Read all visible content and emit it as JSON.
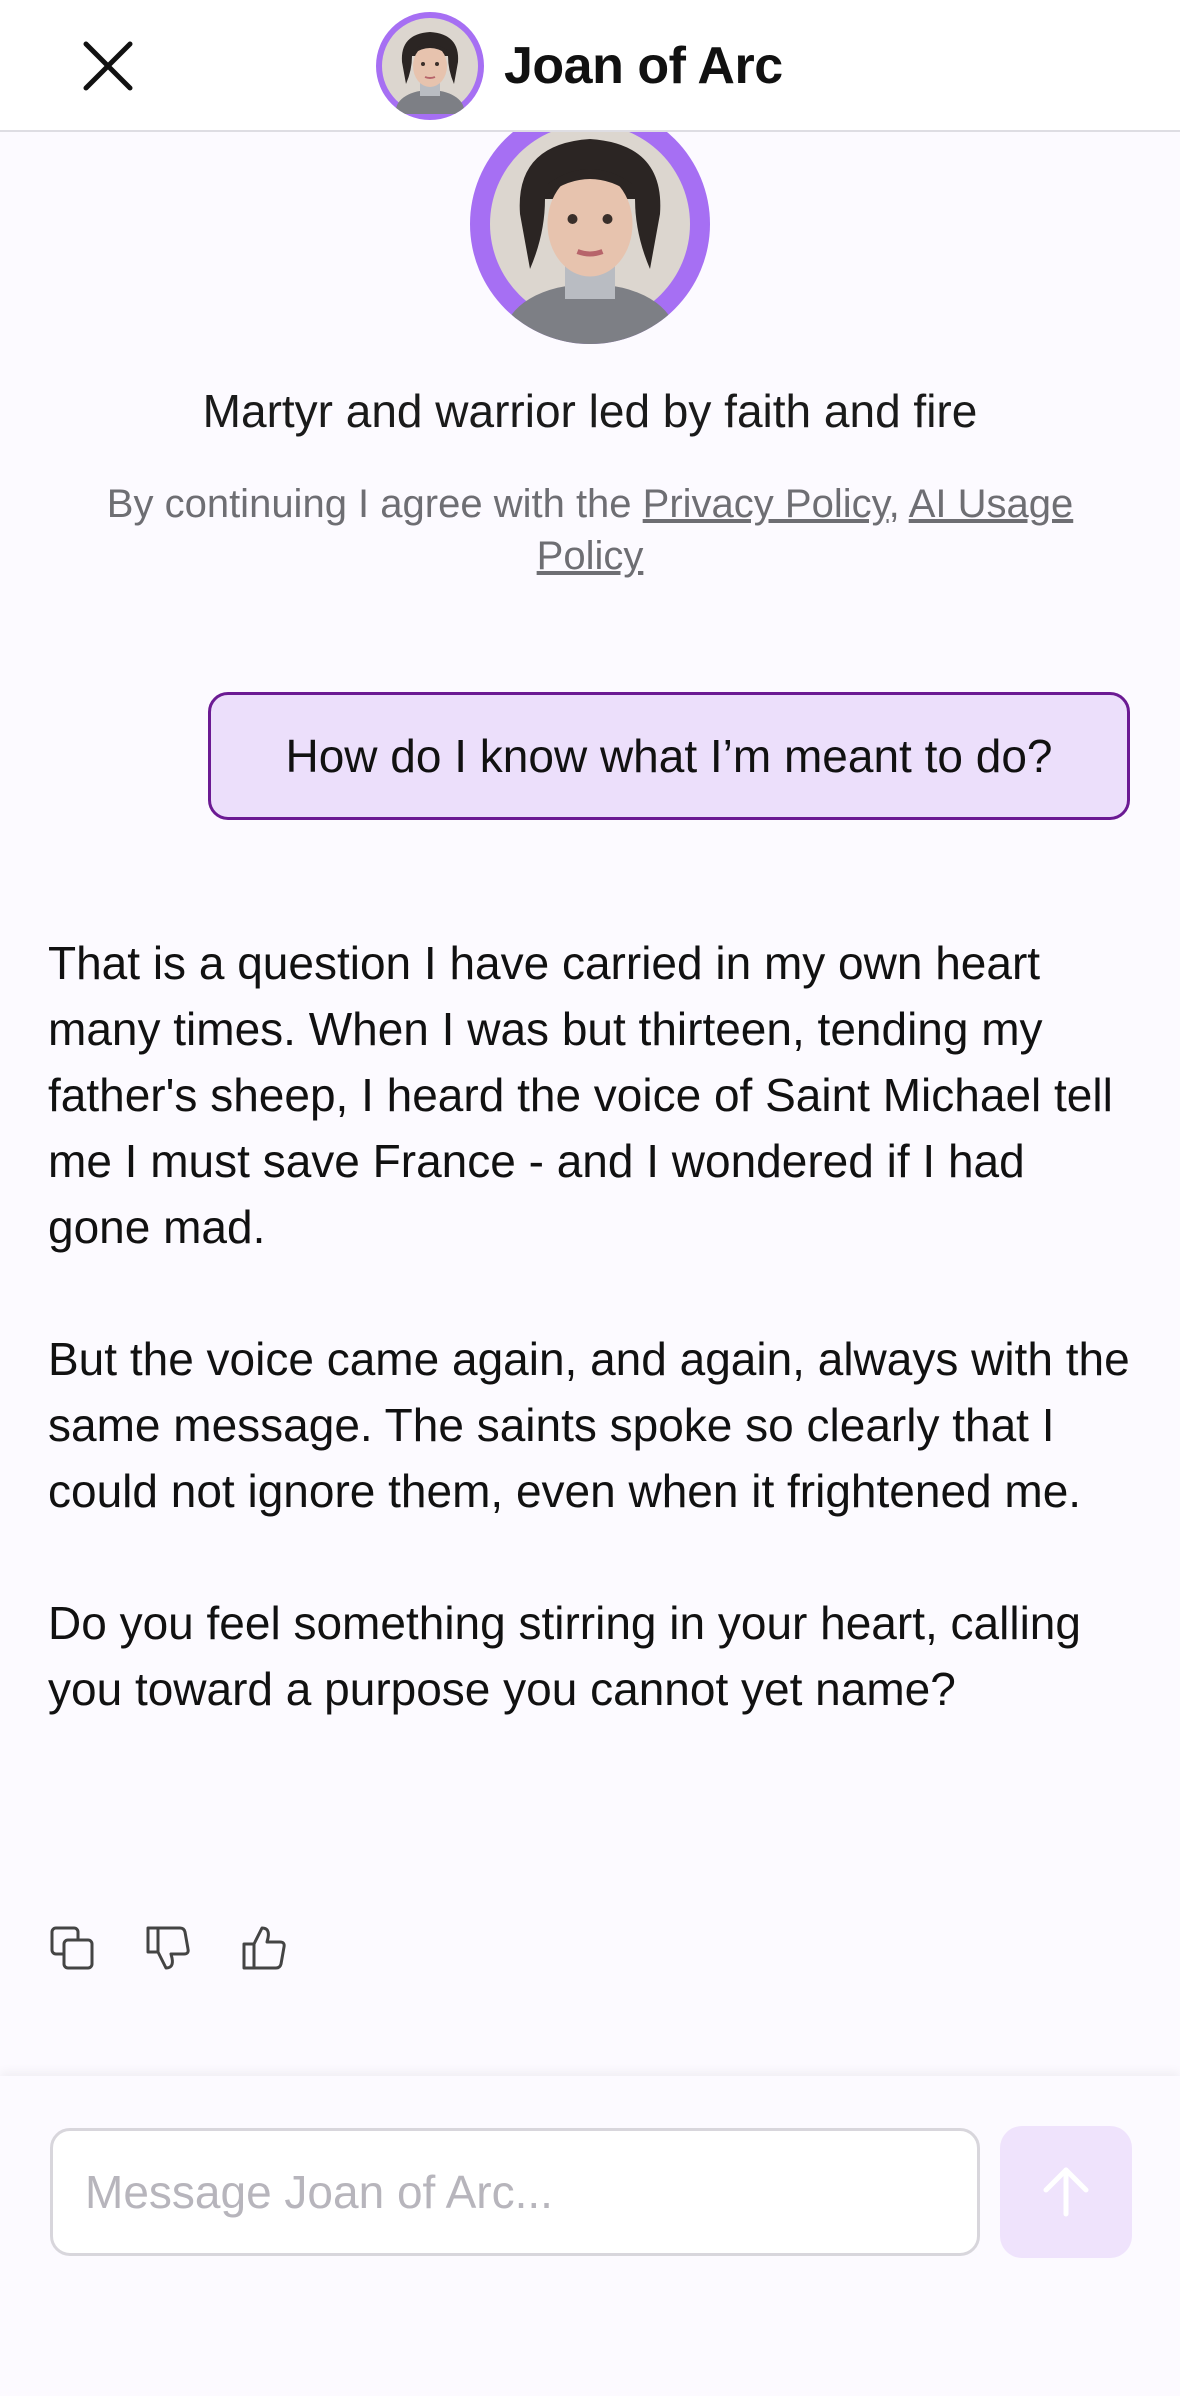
{
  "header": {
    "title": "Joan of Arc",
    "close_icon": "close-icon",
    "avatar_icon": "character-avatar"
  },
  "intro": {
    "tagline": "Martyr and warrior led by faith and fire",
    "policy_prefix": "By continuing I agree with the ",
    "privacy_link": "Privacy Policy",
    "policy_separator": ", ",
    "ai_policy_link": "AI Usage Policy"
  },
  "conversation": {
    "user_message": "How do I know what I’m meant to do?",
    "reply_paragraphs": [
      "That is a question I have carried in my own heart many times. When I was but thirteen, tending my father's sheep, I heard the voice of Saint Michael tell me I must save France - and I wondered if I had gone mad.",
      "But the voice came again, and again, always with the same message. The saints spoke so clearly that I could not ignore them, even when it frightened me.",
      "Do you feel something stirring in your heart, calling you toward a purpose you cannot yet name?"
    ],
    "actions": [
      "copy-icon",
      "thumbs-down-icon",
      "thumbs-up-icon"
    ]
  },
  "composer": {
    "placeholder": "Message Joan of Arc...",
    "value": "",
    "send_icon": "arrow-up-icon"
  },
  "colors": {
    "accent": "#a66ff3",
    "bubble_bg": "#ecdffb",
    "bubble_border": "#6b1a93",
    "send_bg": "#efe3fc"
  }
}
